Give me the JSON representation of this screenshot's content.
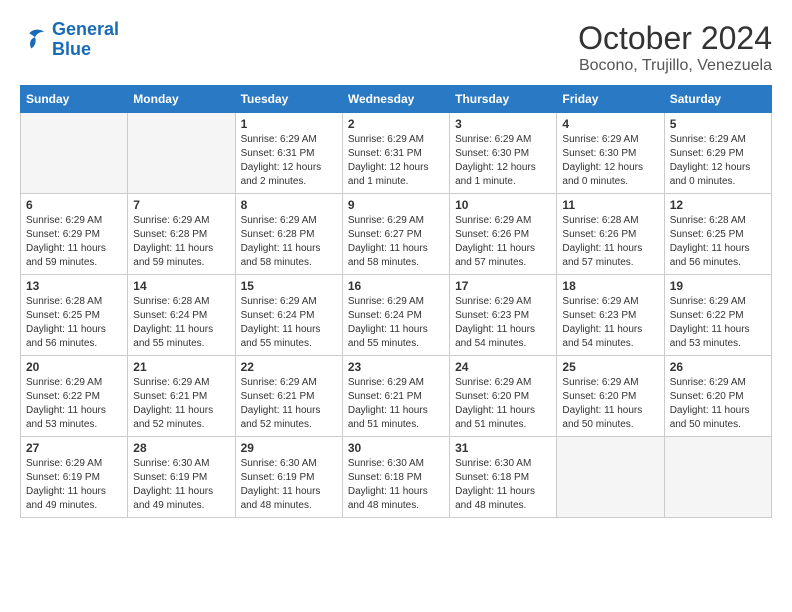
{
  "logo": {
    "line1": "General",
    "line2": "Blue"
  },
  "title": "October 2024",
  "location": "Bocono, Trujillo, Venezuela",
  "days_of_week": [
    "Sunday",
    "Monday",
    "Tuesday",
    "Wednesday",
    "Thursday",
    "Friday",
    "Saturday"
  ],
  "weeks": [
    [
      {
        "day": "",
        "sunrise": "",
        "sunset": "",
        "daylight": ""
      },
      {
        "day": "",
        "sunrise": "",
        "sunset": "",
        "daylight": ""
      },
      {
        "day": "1",
        "sunrise": "Sunrise: 6:29 AM",
        "sunset": "Sunset: 6:31 PM",
        "daylight": "Daylight: 12 hours and 2 minutes."
      },
      {
        "day": "2",
        "sunrise": "Sunrise: 6:29 AM",
        "sunset": "Sunset: 6:31 PM",
        "daylight": "Daylight: 12 hours and 1 minute."
      },
      {
        "day": "3",
        "sunrise": "Sunrise: 6:29 AM",
        "sunset": "Sunset: 6:30 PM",
        "daylight": "Daylight: 12 hours and 1 minute."
      },
      {
        "day": "4",
        "sunrise": "Sunrise: 6:29 AM",
        "sunset": "Sunset: 6:30 PM",
        "daylight": "Daylight: 12 hours and 0 minutes."
      },
      {
        "day": "5",
        "sunrise": "Sunrise: 6:29 AM",
        "sunset": "Sunset: 6:29 PM",
        "daylight": "Daylight: 12 hours and 0 minutes."
      }
    ],
    [
      {
        "day": "6",
        "sunrise": "Sunrise: 6:29 AM",
        "sunset": "Sunset: 6:29 PM",
        "daylight": "Daylight: 11 hours and 59 minutes."
      },
      {
        "day": "7",
        "sunrise": "Sunrise: 6:29 AM",
        "sunset": "Sunset: 6:28 PM",
        "daylight": "Daylight: 11 hours and 59 minutes."
      },
      {
        "day": "8",
        "sunrise": "Sunrise: 6:29 AM",
        "sunset": "Sunset: 6:28 PM",
        "daylight": "Daylight: 11 hours and 58 minutes."
      },
      {
        "day": "9",
        "sunrise": "Sunrise: 6:29 AM",
        "sunset": "Sunset: 6:27 PM",
        "daylight": "Daylight: 11 hours and 58 minutes."
      },
      {
        "day": "10",
        "sunrise": "Sunrise: 6:29 AM",
        "sunset": "Sunset: 6:26 PM",
        "daylight": "Daylight: 11 hours and 57 minutes."
      },
      {
        "day": "11",
        "sunrise": "Sunrise: 6:28 AM",
        "sunset": "Sunset: 6:26 PM",
        "daylight": "Daylight: 11 hours and 57 minutes."
      },
      {
        "day": "12",
        "sunrise": "Sunrise: 6:28 AM",
        "sunset": "Sunset: 6:25 PM",
        "daylight": "Daylight: 11 hours and 56 minutes."
      }
    ],
    [
      {
        "day": "13",
        "sunrise": "Sunrise: 6:28 AM",
        "sunset": "Sunset: 6:25 PM",
        "daylight": "Daylight: 11 hours and 56 minutes."
      },
      {
        "day": "14",
        "sunrise": "Sunrise: 6:28 AM",
        "sunset": "Sunset: 6:24 PM",
        "daylight": "Daylight: 11 hours and 55 minutes."
      },
      {
        "day": "15",
        "sunrise": "Sunrise: 6:29 AM",
        "sunset": "Sunset: 6:24 PM",
        "daylight": "Daylight: 11 hours and 55 minutes."
      },
      {
        "day": "16",
        "sunrise": "Sunrise: 6:29 AM",
        "sunset": "Sunset: 6:24 PM",
        "daylight": "Daylight: 11 hours and 55 minutes."
      },
      {
        "day": "17",
        "sunrise": "Sunrise: 6:29 AM",
        "sunset": "Sunset: 6:23 PM",
        "daylight": "Daylight: 11 hours and 54 minutes."
      },
      {
        "day": "18",
        "sunrise": "Sunrise: 6:29 AM",
        "sunset": "Sunset: 6:23 PM",
        "daylight": "Daylight: 11 hours and 54 minutes."
      },
      {
        "day": "19",
        "sunrise": "Sunrise: 6:29 AM",
        "sunset": "Sunset: 6:22 PM",
        "daylight": "Daylight: 11 hours and 53 minutes."
      }
    ],
    [
      {
        "day": "20",
        "sunrise": "Sunrise: 6:29 AM",
        "sunset": "Sunset: 6:22 PM",
        "daylight": "Daylight: 11 hours and 53 minutes."
      },
      {
        "day": "21",
        "sunrise": "Sunrise: 6:29 AM",
        "sunset": "Sunset: 6:21 PM",
        "daylight": "Daylight: 11 hours and 52 minutes."
      },
      {
        "day": "22",
        "sunrise": "Sunrise: 6:29 AM",
        "sunset": "Sunset: 6:21 PM",
        "daylight": "Daylight: 11 hours and 52 minutes."
      },
      {
        "day": "23",
        "sunrise": "Sunrise: 6:29 AM",
        "sunset": "Sunset: 6:21 PM",
        "daylight": "Daylight: 11 hours and 51 minutes."
      },
      {
        "day": "24",
        "sunrise": "Sunrise: 6:29 AM",
        "sunset": "Sunset: 6:20 PM",
        "daylight": "Daylight: 11 hours and 51 minutes."
      },
      {
        "day": "25",
        "sunrise": "Sunrise: 6:29 AM",
        "sunset": "Sunset: 6:20 PM",
        "daylight": "Daylight: 11 hours and 50 minutes."
      },
      {
        "day": "26",
        "sunrise": "Sunrise: 6:29 AM",
        "sunset": "Sunset: 6:20 PM",
        "daylight": "Daylight: 11 hours and 50 minutes."
      }
    ],
    [
      {
        "day": "27",
        "sunrise": "Sunrise: 6:29 AM",
        "sunset": "Sunset: 6:19 PM",
        "daylight": "Daylight: 11 hours and 49 minutes."
      },
      {
        "day": "28",
        "sunrise": "Sunrise: 6:30 AM",
        "sunset": "Sunset: 6:19 PM",
        "daylight": "Daylight: 11 hours and 49 minutes."
      },
      {
        "day": "29",
        "sunrise": "Sunrise: 6:30 AM",
        "sunset": "Sunset: 6:19 PM",
        "daylight": "Daylight: 11 hours and 48 minutes."
      },
      {
        "day": "30",
        "sunrise": "Sunrise: 6:30 AM",
        "sunset": "Sunset: 6:18 PM",
        "daylight": "Daylight: 11 hours and 48 minutes."
      },
      {
        "day": "31",
        "sunrise": "Sunrise: 6:30 AM",
        "sunset": "Sunset: 6:18 PM",
        "daylight": "Daylight: 11 hours and 48 minutes."
      },
      {
        "day": "",
        "sunrise": "",
        "sunset": "",
        "daylight": ""
      },
      {
        "day": "",
        "sunrise": "",
        "sunset": "",
        "daylight": ""
      }
    ]
  ]
}
